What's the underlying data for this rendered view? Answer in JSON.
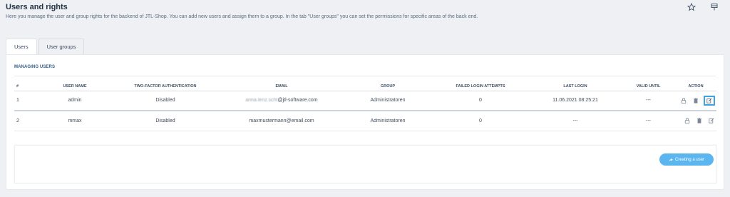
{
  "header": {
    "title": "Users and rights",
    "description": "Here you manage the user and group rights for the backend of JTL-Shop. You can add new users and assign them to a group. In the tab \"User groups\" you can set the permissions for specific areas of the back end.",
    "icons": [
      "star-icon",
      "pin-icon"
    ]
  },
  "tabs": [
    {
      "label": "Users",
      "active": true
    },
    {
      "label": "User groups",
      "active": false
    }
  ],
  "section": {
    "title": "MANAGING USERS"
  },
  "table": {
    "columns": [
      "#",
      "USER NAME",
      "TWO-FACTOR AUTHENTICATION",
      "EMAIL",
      "GROUP",
      "FAILED LOGIN ATTEMPTS",
      "LAST LOGIN",
      "VALID UNTIL",
      "ACTION"
    ],
    "rows": [
      {
        "num": "1",
        "username": "admin",
        "two_factor": "Disabled",
        "email_prefix": "anna.lenz.scht",
        "email_domain": "@jtl-software.com",
        "group": "Administratoren",
        "failed": "0",
        "last_login": "11.06.2021 08:25:21",
        "valid_until": "---"
      },
      {
        "num": "2",
        "username": "mmax",
        "two_factor": "Disabled",
        "email": "maxmustermann@email.com",
        "group": "Administratoren",
        "failed": "0",
        "last_login": "---",
        "valid_until": "---"
      }
    ],
    "action_icons": [
      "lock-icon",
      "trash-icon",
      "edit-icon"
    ]
  },
  "footer": {
    "create_button": "Creating a user"
  },
  "colors": {
    "accent": "#5bb6f0",
    "highlight_border": "#3ba3e6",
    "title": "#243447",
    "background": "#eef0f4"
  }
}
